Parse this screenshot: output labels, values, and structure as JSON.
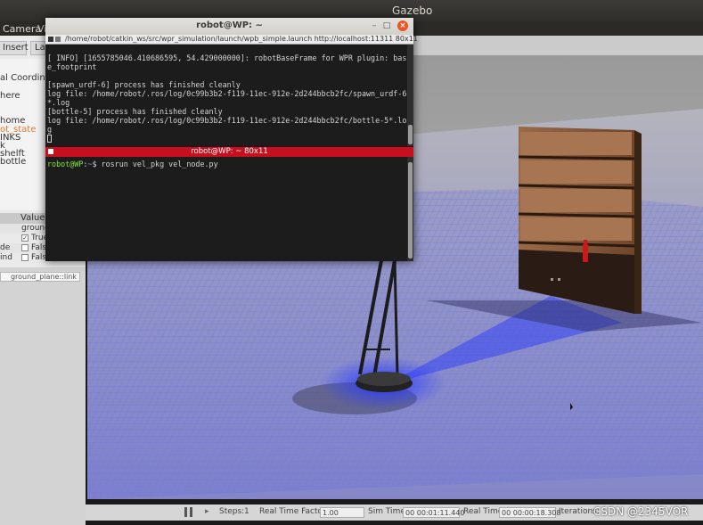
{
  "gazebo": {
    "window_title": "Gazebo",
    "menu": {
      "camera": "Camera",
      "view": "Vi"
    },
    "left_panel": {
      "tabs": [
        "Insert",
        "La"
      ],
      "tree_items": [
        {
          "label": "al Coordinates",
          "selected": false
        },
        {
          "label": "here",
          "selected": false
        },
        {
          "label": "home",
          "selected": false
        },
        {
          "label": "ot_state",
          "selected": true
        },
        {
          "label": "INKS",
          "selected": false
        },
        {
          "label": "k",
          "selected": false
        },
        {
          "label": "shelft",
          "selected": false
        },
        {
          "label": "bottle",
          "selected": false
        }
      ],
      "property_header_value": "Value",
      "properties": [
        {
          "name": "",
          "value": "ground_",
          "checkbox": false
        },
        {
          "name": "",
          "value": "True",
          "checkbox": true,
          "checked": true
        },
        {
          "name": "de",
          "value": "False",
          "checkbox": true,
          "checked": false
        },
        {
          "name": "ind",
          "value": "False",
          "checkbox": true,
          "checked": false
        }
      ],
      "link_field": "ground_plane::link"
    },
    "statusbar": {
      "steps_label": "Steps:",
      "steps_value": "1",
      "rtf_label": "Real Time Factor:",
      "rtf_value": "1.00",
      "sim_time_label": "Sim Time:",
      "sim_time_value": "00 00:01:11.440",
      "real_time_label": "Real Time:",
      "real_time_value": "00 00:00:18.308",
      "iterations_label": "Iterations:"
    }
  },
  "terminal": {
    "window_title": "robot@WP: ~",
    "pane1": {
      "tab_title": "/home/robot/catkin_ws/src/wpr_simulation/launch/wpb_simple.launch http://localhost:11311 80x11",
      "lines": [
        "[ INFO] [1655785046.410686595, 54.429000000]: robotBaseFrame for WPR plugin: bas",
        "e_footprint",
        "",
        "[spawn_urdf-6] process has finished cleanly",
        "log file: /home/robot/.ros/log/0c99b3b2-f119-11ec-912e-2d244bbcb2fc/spawn_urdf-6",
        "*.log",
        "[bottle-5] process has finished cleanly",
        "log file: /home/robot/.ros/log/0c99b3b2-f119-11ec-912e-2d244bbcb2fc/bottle-5*.lo",
        "g"
      ]
    },
    "pane2": {
      "tab_title": "robot@WP: ~ 80x11",
      "prompt_user": "robot@WP",
      "prompt_sep": ":",
      "prompt_path": "~",
      "command": "$ rosrun vel_pkg vel_node.py"
    }
  },
  "watermark": "CSDN @2345VOR",
  "colors": {
    "terminal_bg": "#1c1c1c",
    "active_pane_bar": "#c7101e",
    "laser_blue": "#6c7be8",
    "ubuntu_orange": "#e95420"
  }
}
